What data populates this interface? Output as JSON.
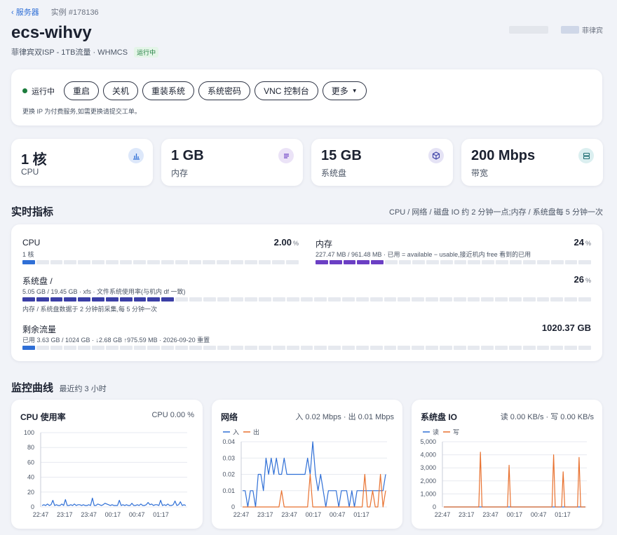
{
  "breadcrumb": {
    "back": "服务器",
    "instance": "实例 #178136"
  },
  "header": {
    "title": "ecs-wihvy",
    "subtitle": "菲律宾双ISP - 1TB流量 · WHMCS",
    "status_badge": "运行中",
    "region_label": "菲律宾"
  },
  "controls": {
    "status": "运行中",
    "buttons": [
      "重启",
      "关机",
      "重装系统",
      "系统密码",
      "VNC 控制台",
      "更多"
    ],
    "note": "更换 IP 为付费服务,如需更换请提交工单。"
  },
  "stats": [
    {
      "value": "1 核",
      "label": "CPU",
      "icon": "chart-icon"
    },
    {
      "value": "1 GB",
      "label": "内存",
      "icon": "list-icon"
    },
    {
      "value": "15 GB",
      "label": "系统盘",
      "icon": "cube-icon"
    },
    {
      "value": "200 Mbps",
      "label": "带宽",
      "icon": "server-icon"
    }
  ],
  "realtime": {
    "title": "实时指标",
    "note": "CPU / 网络 / 磁盘 IO 约 2 分钟一点;内存 / 系统盘每 5 分钟一次",
    "cpu": {
      "name": "CPU",
      "sub": "1 核",
      "value": "2.00",
      "unit": "%",
      "fraction": 0.02
    },
    "memory": {
      "name": "内存",
      "sub": "227.47 MB / 961.48 MB · 已用 = available − usable,接近机内 free 看到的已用",
      "value": "24",
      "unit": "%",
      "fraction": 0.24
    },
    "disk": {
      "name": "系统盘 /",
      "sub": "5.05 GB / 19.45 GB · xfs · 文件系统使用率(与机内 df 一致)",
      "value": "26",
      "unit": "%",
      "note": "内存 / 系统盘数据于 2 分钟前采集,每 5 分钟一次",
      "fraction": 0.26
    },
    "traffic": {
      "name": "剩余流量",
      "sub": "已用 3.63 GB / 1024 GB · ↓2.68 GB ↑975.59 MB · 2026-09-20 重置",
      "value": "1020.37 GB",
      "fraction": 0.0035
    }
  },
  "monitor": {
    "title": "监控曲线",
    "sub": "最近约 3 小时"
  },
  "colors": {
    "accent": "#2f6fd6",
    "memory": "#6b3fc4",
    "disk": "#3b3fa6",
    "orange": "#e8712f",
    "green": "#1c7c3c"
  },
  "chart_data": [
    {
      "type": "line",
      "title": "CPU 使用率",
      "summary": "CPU 0.00 %",
      "ylim": [
        0,
        100
      ],
      "yticks": [
        "100",
        "80",
        "60",
        "40",
        "20",
        "0"
      ],
      "xticks": [
        "22:47",
        "23:17",
        "23:47",
        "00:17",
        "00:47",
        "01:17"
      ],
      "series": [
        {
          "color": "#2f6fd6",
          "values": [
            2,
            3,
            2,
            4,
            2,
            3,
            9,
            2,
            3,
            2,
            2,
            4,
            2,
            10,
            2,
            2,
            3,
            2,
            4,
            2,
            3,
            3,
            2,
            3,
            2,
            2,
            3,
            2,
            12,
            2,
            2,
            4,
            3,
            2,
            3,
            5,
            4,
            3,
            2,
            3,
            2,
            2,
            2,
            9,
            2,
            3,
            2,
            3,
            2,
            2,
            5,
            2,
            2,
            3,
            2,
            4,
            2,
            2,
            3,
            6,
            3,
            4,
            2,
            3,
            3,
            2,
            9,
            2,
            3,
            2,
            4,
            2,
            2,
            3,
            8,
            2,
            3,
            7,
            2,
            3,
            2
          ]
        }
      ]
    },
    {
      "type": "line",
      "title": "网络",
      "summary": "入 0.02 Mbps · 出 0.01 Mbps",
      "ylim": [
        0,
        0.04
      ],
      "yticks": [
        "0.04",
        "0.03",
        "0.02",
        "0.01",
        "0"
      ],
      "xticks": [
        "22:47",
        "23:17",
        "23:47",
        "00:17",
        "00:47",
        "01:17"
      ],
      "legend": [
        "入",
        "出"
      ],
      "series": [
        {
          "name": "入",
          "color": "#2f6fd6",
          "values": [
            0.01,
            0.01,
            0,
            0.01,
            0.01,
            0,
            0.02,
            0.02,
            0.01,
            0.03,
            0.02,
            0.03,
            0.02,
            0.03,
            0.02,
            0.02,
            0.03,
            0.02,
            0.02,
            0.02,
            0.02,
            0.02,
            0.02,
            0.02,
            0.02,
            0.03,
            0.02,
            0.04,
            0.02,
            0.01,
            0.02,
            0.01,
            0,
            0.01,
            0.01,
            0.01,
            0.01,
            0,
            0.01,
            0.01,
            0.01,
            0,
            0.01,
            0,
            0.01,
            0.01,
            0.01,
            0.01,
            0.01,
            0.01,
            0.01,
            0.01,
            0.01,
            0.01,
            0.01,
            0.02
          ]
        },
        {
          "name": "出",
          "color": "#e8712f",
          "values": [
            0,
            0,
            0,
            0,
            0,
            0,
            0,
            0,
            0,
            0,
            0,
            0,
            0,
            0,
            0,
            0.01,
            0,
            0,
            0,
            0,
            0,
            0,
            0,
            0,
            0,
            0,
            0.02,
            0,
            0,
            0,
            0,
            0,
            0,
            0,
            0,
            0,
            0,
            0,
            0,
            0,
            0,
            0,
            0,
            0,
            0,
            0,
            0,
            0.02,
            0,
            0,
            0.01,
            0,
            0,
            0.02,
            0,
            0.01
          ]
        }
      ]
    },
    {
      "type": "line",
      "title": "系统盘 IO",
      "summary": "读 0.00 KB/s · 写 0.00 KB/s",
      "ylim": [
        0,
        5000
      ],
      "yticks": [
        "5,000",
        "4,000",
        "3,000",
        "2,000",
        "1,000",
        "0"
      ],
      "xticks": [
        "22:47",
        "23:17",
        "23:47",
        "00:17",
        "00:47",
        "01:17"
      ],
      "legend": [
        "读",
        "写"
      ],
      "series": [
        {
          "name": "读",
          "color": "#2f6fd6",
          "values": [
            0,
            0,
            0,
            0,
            0,
            0,
            0,
            0,
            0,
            0,
            0,
            0,
            0,
            0,
            0,
            0,
            0,
            0,
            0,
            0,
            0,
            0,
            0,
            0,
            0,
            0,
            0,
            0,
            0,
            0,
            0,
            0,
            0,
            0,
            0,
            0,
            0,
            0,
            0,
            0,
            0,
            0,
            0,
            0,
            0,
            0,
            0,
            0,
            0,
            0,
            0,
            0,
            0,
            0,
            0,
            0,
            0,
            0,
            0,
            0,
            0,
            0,
            0,
            0,
            0,
            0,
            0,
            0,
            0,
            0,
            0,
            0,
            0,
            0,
            0,
            0,
            0,
            0,
            0,
            0,
            0,
            0,
            0,
            0,
            0,
            0,
            0,
            0,
            0,
            0
          ]
        },
        {
          "name": "写",
          "color": "#e8712f",
          "values": [
            0,
            0,
            0,
            0,
            0,
            0,
            0,
            0,
            0,
            0,
            0,
            0,
            0,
            0,
            0,
            0,
            0,
            0,
            0,
            0,
            0,
            0,
            0,
            4200,
            0,
            0,
            0,
            0,
            0,
            0,
            0,
            0,
            0,
            0,
            0,
            0,
            0,
            0,
            0,
            0,
            0,
            3200,
            0,
            0,
            0,
            0,
            0,
            0,
            0,
            0,
            0,
            0,
            0,
            0,
            0,
            0,
            0,
            0,
            0,
            0,
            0,
            0,
            0,
            0,
            0,
            0,
            0,
            0,
            0,
            4000,
            0,
            0,
            0,
            0,
            0,
            2700,
            0,
            0,
            0,
            0,
            0,
            0,
            0,
            0,
            0,
            3800,
            0,
            0,
            0,
            0
          ]
        }
      ]
    }
  ]
}
